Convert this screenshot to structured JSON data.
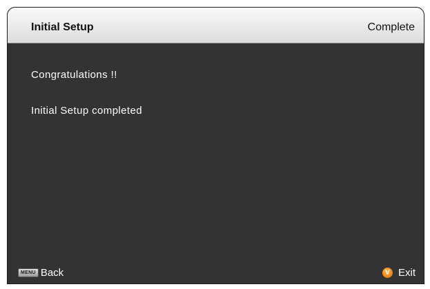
{
  "header": {
    "title": "Initial Setup",
    "status": "Complete"
  },
  "content": {
    "lines": [
      "Congratulations !!",
      "Initial Setup completed"
    ]
  },
  "footer": {
    "back": {
      "key_label": "MENU",
      "label": "Back",
      "icon": "menu-key-icon"
    },
    "exit": {
      "icon_glyph": "V",
      "label": "Exit",
      "icon": "vizio-v-icon",
      "icon_color": "#f07d00"
    }
  }
}
